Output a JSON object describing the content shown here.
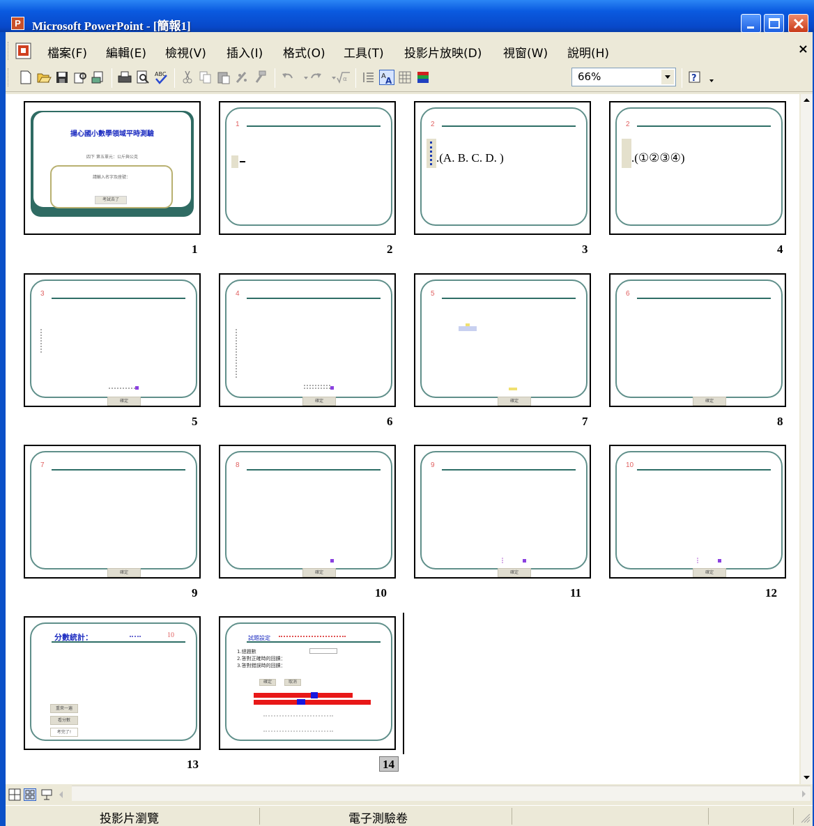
{
  "window": {
    "app_icon": "P",
    "title": "Microsoft PowerPoint - [簡報1]"
  },
  "menu": {
    "items": [
      "檔案(F)",
      "編輯(E)",
      "檢視(V)",
      "插入(I)",
      "格式(O)",
      "工具(T)",
      "投影片放映(D)",
      "視窗(W)",
      "說明(H)"
    ],
    "close": "×"
  },
  "toolbar": {
    "zoom": "66%",
    "icons": [
      "new-icon",
      "open-icon",
      "save-icon",
      "permission-icon",
      "email-icon",
      "print-icon",
      "print-preview-icon",
      "spelling-icon",
      "cut-icon",
      "copy-icon",
      "paste-icon",
      "format-painter-icon",
      "insert-ink-icon",
      "undo-icon",
      "redo-icon",
      "equation-icon",
      "expand-icon",
      "show-formatting-icon",
      "grid-icon",
      "color-grayscale-icon",
      "help-icon"
    ]
  },
  "slides": [
    {
      "num": "1",
      "title": "揚心國小數學領域平時測驗",
      "subtitle": "四下  第五單元：公斤與公克",
      "box_text": "請輸入名字及座號：",
      "button": "考試去了"
    },
    {
      "num": "2",
      "marker": "1"
    },
    {
      "num": "3",
      "marker": "2",
      "choices": ".(A. B. C. D. )"
    },
    {
      "num": "4",
      "marker": "2",
      "choices": ".(①②③④)"
    },
    {
      "num": "5",
      "marker": "3",
      "button": "確定"
    },
    {
      "num": "6",
      "marker": "4",
      "button": "確定"
    },
    {
      "num": "7",
      "marker": "5",
      "button": "確定"
    },
    {
      "num": "8",
      "marker": "6",
      "button": "確定"
    },
    {
      "num": "9",
      "marker": "7",
      "button": "確定"
    },
    {
      "num": "10",
      "marker": "8",
      "button": "確定"
    },
    {
      "num": "11",
      "marker": "9",
      "button": "確定"
    },
    {
      "num": "12",
      "marker": "10",
      "button": "確定"
    },
    {
      "num": "13",
      "title": "分數統計：",
      "score": "10",
      "buttons": [
        "重來一遍",
        "看分數",
        "考完了!"
      ]
    },
    {
      "num": "14",
      "title": "試題設定",
      "lines": [
        "1.總題數",
        "2.答對正確時的回饋：",
        "3.答對錯誤時的回饋："
      ],
      "buttons": [
        "確定",
        "取消"
      ]
    }
  ],
  "selected_slide": "14",
  "status": {
    "view": "投影片瀏覽",
    "design": "電子測驗卷"
  }
}
